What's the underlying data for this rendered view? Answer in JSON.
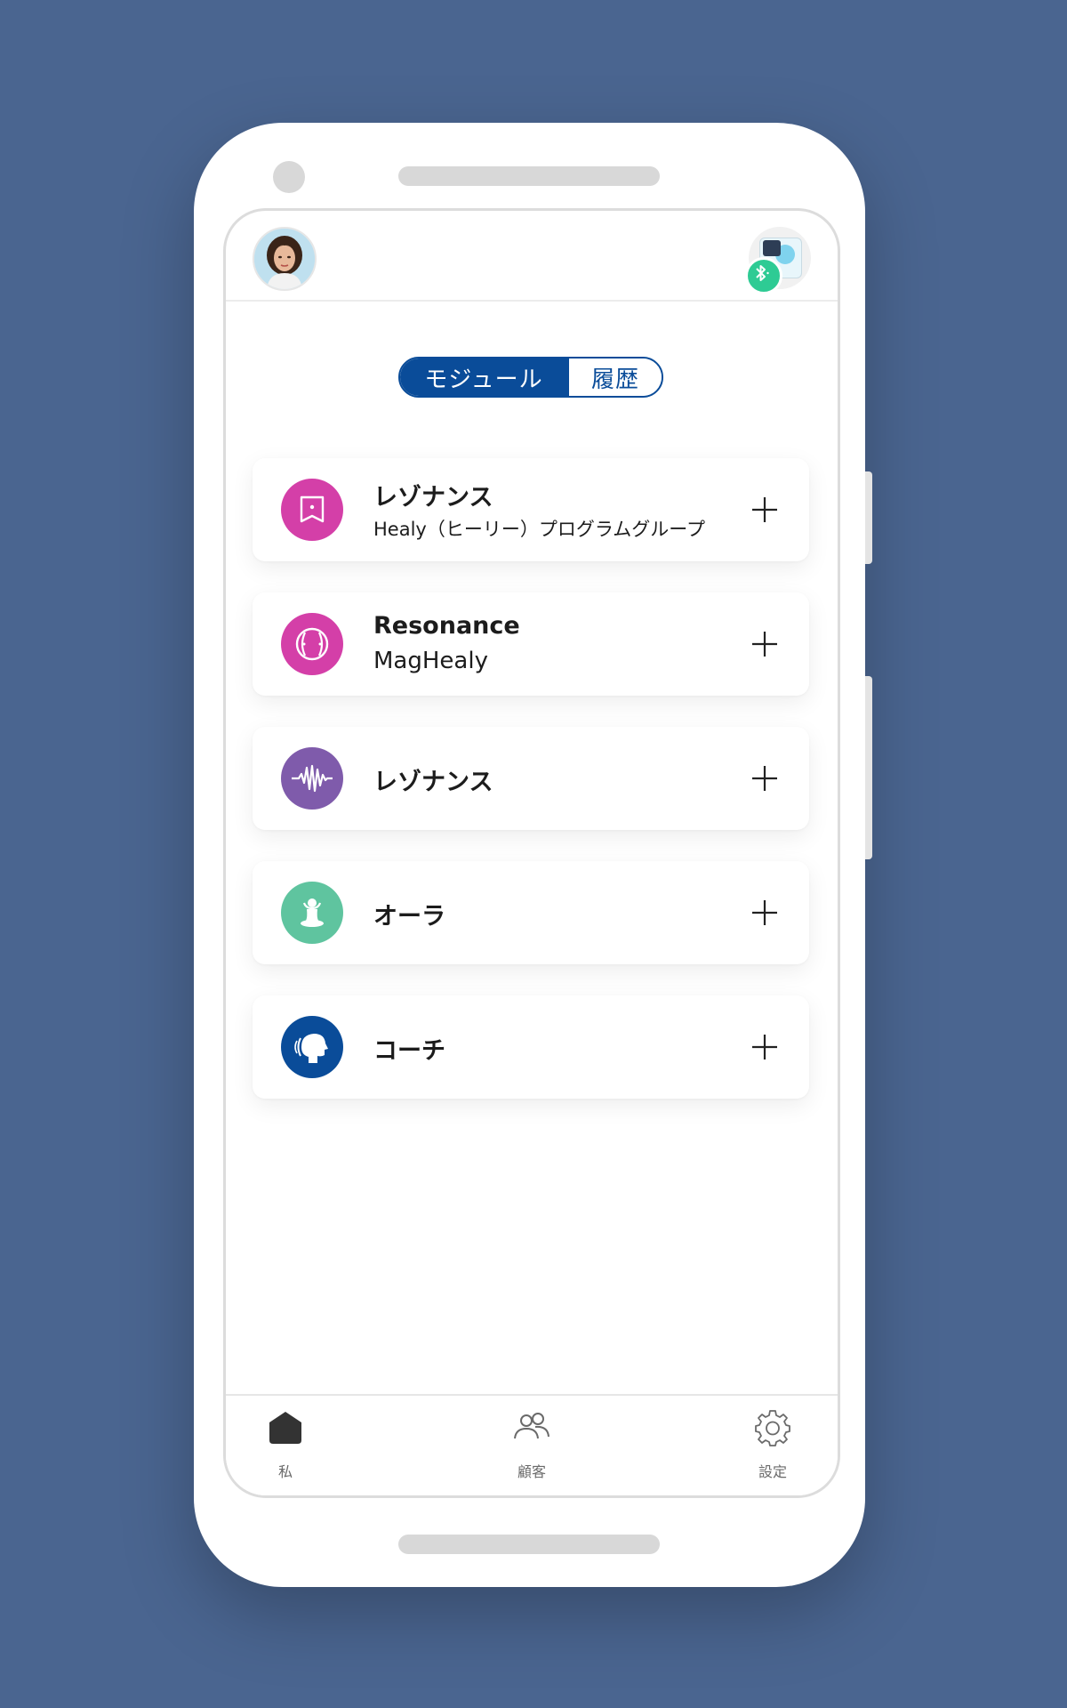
{
  "segmented_control": {
    "active_label": "モジュール",
    "inactive_label": "履歴"
  },
  "modules": [
    {
      "title": "レゾナンス",
      "subtitle": "Healy（ヒーリー）プログラムグループ",
      "icon": "square-dot-icon",
      "color": "#d43fa8"
    },
    {
      "title": "Resonance",
      "subtitle": "MagHealy",
      "icon": "ball-icon",
      "color": "#d43fa8"
    },
    {
      "title": "レゾナンス",
      "subtitle": "",
      "icon": "waveform-icon",
      "color": "#7f5bab"
    },
    {
      "title": "オーラ",
      "subtitle": "",
      "icon": "meditation-figure-icon",
      "color": "#5fc49f"
    },
    {
      "title": "コーチ",
      "subtitle": "",
      "icon": "head-profile-icon",
      "color": "#0a4c99"
    }
  ],
  "bottom_nav": {
    "me_label": "私",
    "customers_label": "顧客",
    "settings_label": "設定"
  },
  "status": {
    "device_connected": "bluetooth-icon",
    "device_badge_color": "#2ecb94"
  },
  "theme": {
    "primary": "#0a4c99",
    "background": "#4a6590"
  }
}
